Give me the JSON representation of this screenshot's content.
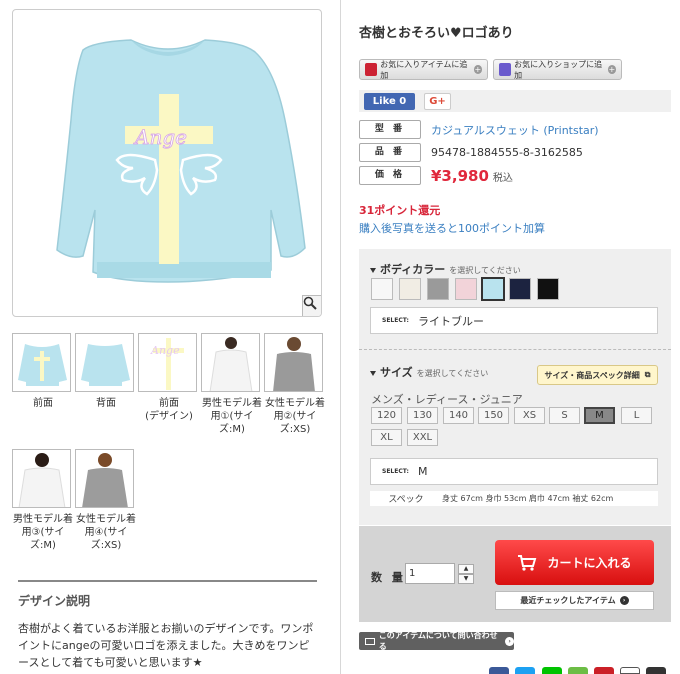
{
  "product": {
    "title": "杏樹とおそろい♥ロゴあり",
    "model_label": "型 番",
    "model_value": "カジュアルスウェット (Printstar)",
    "code_label": "品 番",
    "code_value": "95478-1884555-8-3162585",
    "price_label": "価 格",
    "price_value": "¥3,980",
    "tax_label": "税込",
    "points_text": "31ポイント還元",
    "photo_link": "購入後写真を送ると100ポイント加算",
    "print_logo_text": "Ange",
    "print_colors": {
      "body": "#b9e3ee",
      "cross": "#fbf8c4",
      "wings": "#ffffff"
    }
  },
  "actions": {
    "fav_item": "お気に入りアイテムに追加",
    "fav_shop": "お気に入りショップに追加",
    "like": "Like 0",
    "gplus": "G+",
    "cart": "カートに入れる",
    "recent": "最近チェックしたアイテム",
    "contact": "このアイテムについて問い合わせる",
    "zoom_icon": "magnifier-icon"
  },
  "thumbnails": [
    {
      "caption": "前面"
    },
    {
      "caption": "背面"
    },
    {
      "caption": "前面\n(デザイン)"
    },
    {
      "caption": "男性モデル着用①(サイズ:M)"
    },
    {
      "caption": "女性モデル着用②(サイズ:XS)"
    },
    {
      "caption": "男性モデル着用③(サイズ:M)"
    },
    {
      "caption": "女性モデル着用④(サイズ:XS)"
    }
  ],
  "design": {
    "title": "デザイン説明",
    "text": "杏樹がよく着ているお洋服とお揃いのデザインです。ワンポイントにangeの可愛いロゴを添えました。大きめをワンピースとして着ても可愛いと思います★"
  },
  "color_option": {
    "heading": "ボディカラー",
    "hint": "を選択してください",
    "swatches": [
      "#f7f7f7",
      "#f1ede4",
      "#9a9a9a",
      "#f2d3d9",
      "#b9e3ee",
      "#1c2340",
      "#111111"
    ],
    "selected_index": 4,
    "select_tag": "SELECT:",
    "selected": "ライトブルー"
  },
  "size_option": {
    "heading": "サイズ",
    "hint": "を選択してください",
    "detail_button": "サイズ・商品スペック詳細",
    "category": "メンズ・レディース・ジュニア",
    "sizes": [
      "120",
      "130",
      "140",
      "150",
      "XS",
      "S",
      "M",
      "L",
      "XL",
      "XXL"
    ],
    "selected_index": 6,
    "select_tag": "SELECT:",
    "selected": "M",
    "spec_key": "スペック",
    "spec_value": "身丈 67cm 身巾 53cm 肩巾 47cm 袖丈 62cm"
  },
  "quantity": {
    "label": "数 量",
    "value": "1",
    "up": "▲",
    "down": "▼"
  }
}
